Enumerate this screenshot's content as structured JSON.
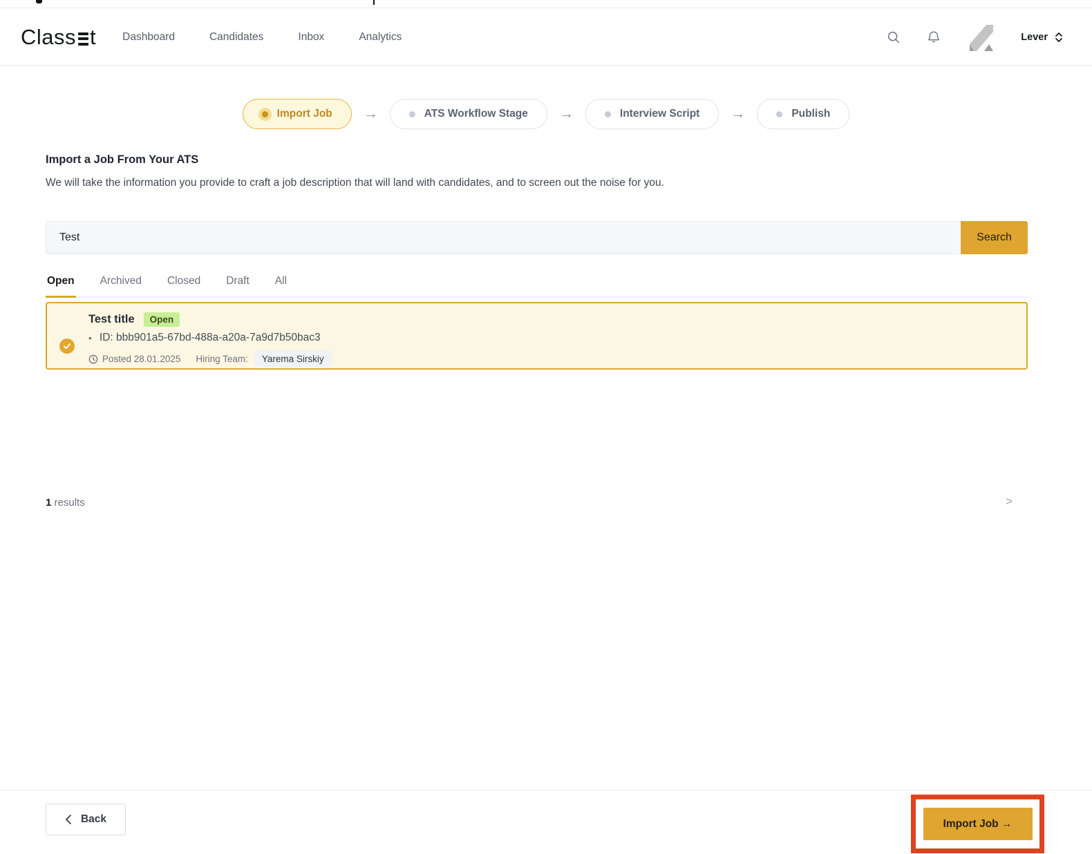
{
  "header": {
    "logo": {
      "prefix": "Class",
      "suffix": "t"
    },
    "nav": [
      {
        "label": "Dashboard"
      },
      {
        "label": "Candidates"
      },
      {
        "label": "Inbox"
      },
      {
        "label": "Analytics"
      }
    ],
    "account": {
      "name": "Lever"
    }
  },
  "stepper": {
    "arrow": "→",
    "steps": [
      {
        "label": "Import Job",
        "state": "active"
      },
      {
        "label": "ATS Workflow Stage",
        "state": "upcoming"
      },
      {
        "label": "Interview Script",
        "state": "upcoming"
      },
      {
        "label": "Publish",
        "state": "upcoming"
      }
    ]
  },
  "intro": {
    "title": "Import a Job From Your ATS",
    "description": "We will take the information you provide to craft a job description that will land with candidates, and to screen out the noise for you."
  },
  "search": {
    "value": "Test",
    "button_label": "Search"
  },
  "tabs": [
    {
      "label": "Open",
      "active": true
    },
    {
      "label": "Archived",
      "active": false
    },
    {
      "label": "Closed",
      "active": false
    },
    {
      "label": "Draft",
      "active": false
    },
    {
      "label": "All",
      "active": false
    }
  ],
  "job_results": [
    {
      "title": "Test title",
      "status_badge": "Open",
      "bullet": "•",
      "id_text": "ID: bbb901a5-67bd-488a-a20a-7a9d7b50bac3",
      "posted": "Posted 28.01.2025",
      "hiring_team_label": "Hiring Team:",
      "hiring_team": "Yarema Sirskiy",
      "selected": true
    }
  ],
  "results_summary": {
    "count": "1",
    "label": "results"
  },
  "pagination": {
    "next": ">"
  },
  "footer": {
    "back_label": "Back",
    "import_label": "Import Job →"
  },
  "colors": {
    "accent_gold": "#DEA531",
    "card_border_gold": "#D9A72E",
    "card_bg": "#FCF7E2",
    "active_pill_bg": "#FDF7DE",
    "badge_green_bg": "#C6EF97",
    "annotation_red": "#E0421F"
  }
}
